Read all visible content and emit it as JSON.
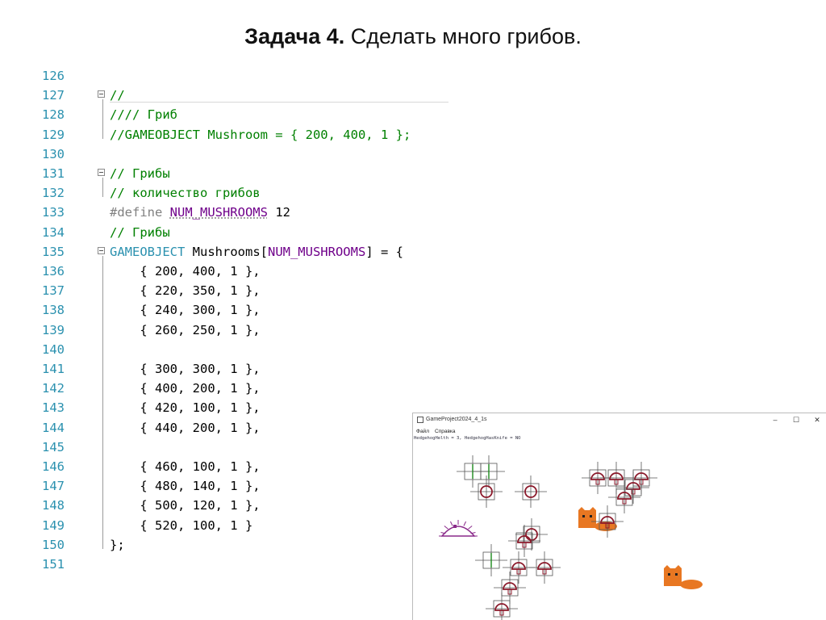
{
  "slide": {
    "title_bold": "Задача 4.",
    "title_rest": " Сделать много грибов."
  },
  "code": {
    "line_numbers": [
      "126",
      "127",
      "128",
      "129",
      "130",
      "131",
      "132",
      "133",
      "134",
      "135",
      "136",
      "137",
      "138",
      "139",
      "140",
      "141",
      "142",
      "143",
      "144",
      "145",
      "146",
      "147",
      "148",
      "149",
      "150",
      "151"
    ],
    "lines": [
      [],
      [
        {
          "t": "//",
          "c": "c-green"
        }
      ],
      [
        {
          "t": "//// Гриб",
          "c": "c-green"
        }
      ],
      [
        {
          "t": "//GAMEOBJECT Mushroom = { 200, 400, 1 };",
          "c": "c-green"
        }
      ],
      [],
      [
        {
          "t": "// Грибы",
          "c": "c-green"
        }
      ],
      [
        {
          "t": "// количество грибов",
          "c": "c-green"
        }
      ],
      [
        {
          "t": "#define ",
          "c": "c-gray"
        },
        {
          "t": "NUM_MUSHROOMS",
          "c": "c-macro sq"
        },
        {
          "t": " 12",
          "c": ""
        }
      ],
      [
        {
          "t": "// Грибы",
          "c": "c-green"
        }
      ],
      [
        {
          "t": "GAMEOBJECT",
          "c": "c-type"
        },
        {
          "t": " Mushrooms[",
          "c": ""
        },
        {
          "t": "NUM_MUSHROOMS",
          "c": "c-macro"
        },
        {
          "t": "] = {",
          "c": ""
        }
      ],
      [
        {
          "t": "    { 200, 400, 1 },",
          "c": ""
        }
      ],
      [
        {
          "t": "    { 220, 350, 1 },",
          "c": ""
        }
      ],
      [
        {
          "t": "    { 240, 300, 1 },",
          "c": ""
        }
      ],
      [
        {
          "t": "    { 260, 250, 1 },",
          "c": ""
        }
      ],
      [],
      [
        {
          "t": "    { 300, 300, 1 },",
          "c": ""
        }
      ],
      [
        {
          "t": "    { 400, 200, 1 },",
          "c": ""
        }
      ],
      [
        {
          "t": "    { 420, 100, 1 },",
          "c": ""
        }
      ],
      [
        {
          "t": "    { 440, 200, 1 },",
          "c": ""
        }
      ],
      [],
      [
        {
          "t": "    { 460, 100, 1 },",
          "c": ""
        }
      ],
      [
        {
          "t": "    { 480, 140, 1 },",
          "c": ""
        }
      ],
      [
        {
          "t": "    { 500, 120, 1 },",
          "c": ""
        }
      ],
      [
        {
          "t": "    { 520, 100, 1 }",
          "c": ""
        }
      ],
      [
        {
          "t": "};",
          "c": ""
        }
      ],
      []
    ]
  },
  "game_window": {
    "title": "GameProject2024_4_1s",
    "menu": [
      "Файл",
      "Справка"
    ],
    "status": "HedgehogHelth = 3, HedgehogHasKnife = NO",
    "controls": [
      "–",
      "☐",
      "✕"
    ],
    "colors": {
      "mushroom": "#8b1a2b",
      "crosshair": "#555555",
      "cat": "#e87722",
      "hedgehog": "#8a2a8a",
      "hedgehog_box": "#1a8a1a"
    }
  }
}
